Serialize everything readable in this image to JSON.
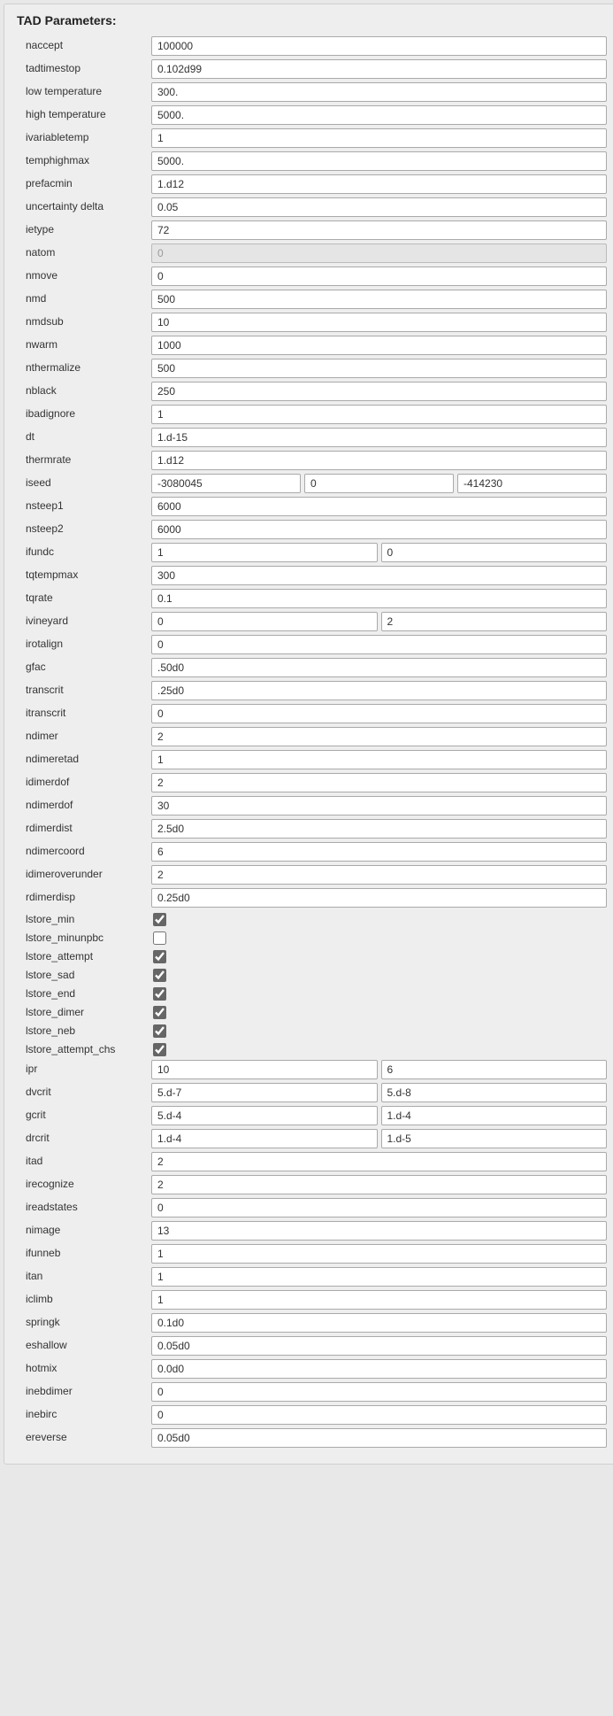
{
  "section_title": "TAD Parameters:",
  "rows": [
    {
      "key": "naccept",
      "label": "naccept",
      "values": [
        "100000"
      ]
    },
    {
      "key": "tadtimestop",
      "label": "tadtimestop",
      "values": [
        "0.102d99"
      ]
    },
    {
      "key": "low-temperature",
      "label": "low temperature",
      "values": [
        "300."
      ]
    },
    {
      "key": "high-temperature",
      "label": "high temperature",
      "values": [
        "5000."
      ]
    },
    {
      "key": "ivariabletemp",
      "label": "ivariabletemp",
      "values": [
        "1"
      ]
    },
    {
      "key": "temphighmax",
      "label": "temphighmax",
      "values": [
        "5000."
      ]
    },
    {
      "key": "prefacmin",
      "label": "prefacmin",
      "values": [
        "1.d12"
      ]
    },
    {
      "key": "uncertainty-delta",
      "label": "uncertainty delta",
      "values": [
        "0.05"
      ]
    },
    {
      "key": "ietype",
      "label": "ietype",
      "values": [
        "72"
      ]
    },
    {
      "key": "natom",
      "label": "natom",
      "values": [
        "0"
      ],
      "disabled": true
    },
    {
      "key": "nmove",
      "label": "nmove",
      "values": [
        "0"
      ]
    },
    {
      "key": "nmd",
      "label": "nmd",
      "values": [
        "500"
      ]
    },
    {
      "key": "nmdsub",
      "label": "nmdsub",
      "values": [
        "10"
      ]
    },
    {
      "key": "nwarm",
      "label": "nwarm",
      "values": [
        "1000"
      ]
    },
    {
      "key": "nthermalize",
      "label": "nthermalize",
      "values": [
        "500"
      ]
    },
    {
      "key": "nblack",
      "label": "nblack",
      "values": [
        "250"
      ]
    },
    {
      "key": "ibadignore",
      "label": "ibadignore",
      "values": [
        "1"
      ]
    },
    {
      "key": "dt",
      "label": "dt",
      "values": [
        "1.d-15"
      ]
    },
    {
      "key": "thermrate",
      "label": "thermrate",
      "values": [
        "1.d12"
      ]
    },
    {
      "key": "iseed",
      "label": "iseed",
      "values": [
        "-3080045",
        "0",
        "-414230"
      ]
    },
    {
      "key": "nsteep1",
      "label": "nsteep1",
      "values": [
        "6000"
      ]
    },
    {
      "key": "nsteep2",
      "label": "nsteep2",
      "values": [
        "6000"
      ]
    },
    {
      "key": "ifundc",
      "label": "ifundc",
      "values": [
        "1",
        "0"
      ]
    },
    {
      "key": "tqtempmax",
      "label": "tqtempmax",
      "values": [
        "300"
      ]
    },
    {
      "key": "tqrate",
      "label": "tqrate",
      "values": [
        "0.1"
      ]
    },
    {
      "key": "ivineyard",
      "label": "ivineyard",
      "values": [
        "0",
        "2"
      ]
    },
    {
      "key": "irotalign",
      "label": "irotalign",
      "values": [
        "0"
      ]
    },
    {
      "key": "gfac",
      "label": "gfac",
      "values": [
        ".50d0"
      ]
    },
    {
      "key": "transcrit",
      "label": "transcrit",
      "values": [
        ".25d0"
      ]
    },
    {
      "key": "itranscrit",
      "label": "itranscrit",
      "values": [
        "0"
      ]
    },
    {
      "key": "ndimer",
      "label": "ndimer",
      "values": [
        "2"
      ]
    },
    {
      "key": "ndimeretad",
      "label": "ndimeretad",
      "values": [
        "1"
      ]
    },
    {
      "key": "idimerdof",
      "label": "idimerdof",
      "values": [
        "2"
      ]
    },
    {
      "key": "ndimerdof",
      "label": "ndimerdof",
      "values": [
        "30"
      ]
    },
    {
      "key": "rdimerdist",
      "label": "rdimerdist",
      "values": [
        "2.5d0"
      ]
    },
    {
      "key": "ndimercoord",
      "label": "ndimercoord",
      "values": [
        "6"
      ]
    },
    {
      "key": "idimeroverunder",
      "label": "idimeroverunder",
      "values": [
        "2"
      ]
    },
    {
      "key": "rdimerdisp",
      "label": "rdimerdisp",
      "values": [
        "0.25d0"
      ]
    },
    {
      "key": "lstore_min",
      "label": "lstore_min",
      "check": true
    },
    {
      "key": "lstore_minunpbc",
      "label": "lstore_minunpbc",
      "check": false
    },
    {
      "key": "lstore_attempt",
      "label": "lstore_attempt",
      "check": true
    },
    {
      "key": "lstore_sad",
      "label": "lstore_sad",
      "check": true
    },
    {
      "key": "lstore_end",
      "label": "lstore_end",
      "check": true
    },
    {
      "key": "lstore_dimer",
      "label": "lstore_dimer",
      "check": true
    },
    {
      "key": "lstore_neb",
      "label": "lstore_neb",
      "check": true
    },
    {
      "key": "lstore_attempt_chs",
      "label": "lstore_attempt_chs",
      "check": true
    },
    {
      "key": "ipr",
      "label": "ipr",
      "values": [
        "10",
        "6"
      ]
    },
    {
      "key": "dvcrit",
      "label": "dvcrit",
      "values": [
        "5.d-7",
        "5.d-8"
      ]
    },
    {
      "key": "gcrit",
      "label": "gcrit",
      "values": [
        "5.d-4",
        "1.d-4"
      ]
    },
    {
      "key": "drcrit",
      "label": "drcrit",
      "values": [
        "1.d-4",
        "1.d-5"
      ]
    },
    {
      "key": "itad",
      "label": "itad",
      "values": [
        "2"
      ]
    },
    {
      "key": "irecognize",
      "label": "irecognize",
      "values": [
        "2"
      ]
    },
    {
      "key": "ireadstates",
      "label": "ireadstates",
      "values": [
        "0"
      ]
    },
    {
      "key": "nimage",
      "label": "nimage",
      "values": [
        "13"
      ]
    },
    {
      "key": "ifunneb",
      "label": "ifunneb",
      "values": [
        "1"
      ]
    },
    {
      "key": "itan",
      "label": "itan",
      "values": [
        "1"
      ]
    },
    {
      "key": "iclimb",
      "label": "iclimb",
      "values": [
        "1"
      ]
    },
    {
      "key": "springk",
      "label": "springk",
      "values": [
        "0.1d0"
      ]
    },
    {
      "key": "eshallow",
      "label": "eshallow",
      "values": [
        "0.05d0"
      ]
    },
    {
      "key": "hotmix",
      "label": "hotmix",
      "values": [
        "0.0d0"
      ]
    },
    {
      "key": "inebdimer",
      "label": "inebdimer",
      "values": [
        "0"
      ]
    },
    {
      "key": "inebirc",
      "label": "inebirc",
      "values": [
        "0"
      ]
    },
    {
      "key": "ereverse",
      "label": "ereverse",
      "values": [
        "0.05d0"
      ]
    }
  ],
  "scrollbar": {
    "thumb_top_pct": 85,
    "thumb_height_pct": 8
  }
}
